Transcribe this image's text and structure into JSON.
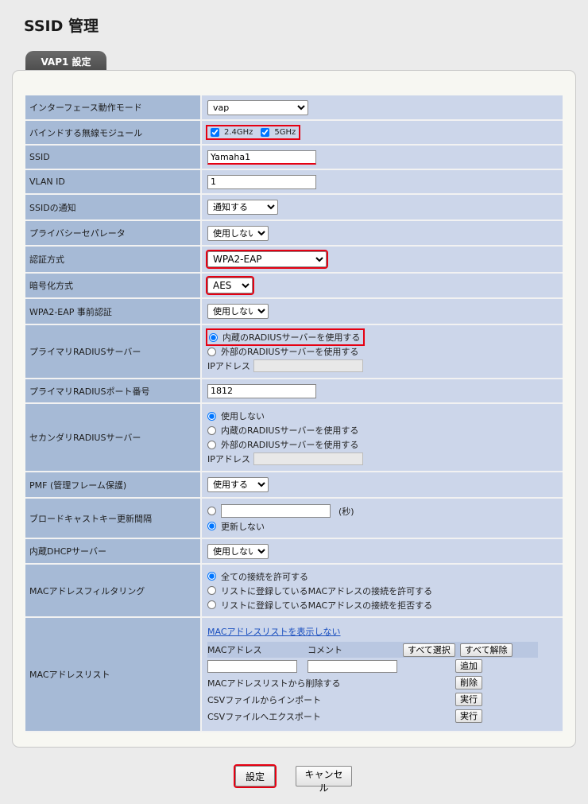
{
  "page": {
    "title": "SSID 管理",
    "tab_label": "VAP1 設定"
  },
  "rows": {
    "interface_mode": {
      "label": "インターフェース動作モード",
      "value": "vap"
    },
    "bind_module": {
      "label": "バインドする無線モジュール",
      "opt_24": "2.4GHz",
      "opt_5": "5GHz"
    },
    "ssid": {
      "label": "SSID",
      "value": "Yamaha1"
    },
    "vlan_id": {
      "label": "VLAN ID",
      "value": "1"
    },
    "ssid_notify": {
      "label": "SSIDの通知",
      "value": "通知する"
    },
    "privacy_separator": {
      "label": "プライバシーセパレータ",
      "value": "使用しない"
    },
    "auth_method": {
      "label": "認証方式",
      "value": "WPA2-EAP"
    },
    "encryption": {
      "label": "暗号化方式",
      "value": "AES"
    },
    "wpa2_preauth": {
      "label": "WPA2-EAP 事前認証",
      "value": "使用しない"
    },
    "primary_radius": {
      "label": "プライマリRADIUSサーバー",
      "opt_internal": "内蔵のRADIUSサーバーを使用する",
      "opt_external": "外部のRADIUSサーバーを使用する",
      "ip_label": "IPアドレス"
    },
    "primary_radius_port": {
      "label": "プライマリRADIUSポート番号",
      "value": "1812"
    },
    "secondary_radius": {
      "label": "セカンダリRADIUSサーバー",
      "opt_none": "使用しない",
      "opt_internal": "内蔵のRADIUSサーバーを使用する",
      "opt_external": "外部のRADIUSサーバーを使用する",
      "ip_label": "IPアドレス"
    },
    "pmf": {
      "label": "PMF (管理フレーム保護)",
      "value": "使用する"
    },
    "broadcast_key": {
      "label": "ブロードキャストキー更新間隔",
      "unit": "(秒)",
      "opt_no_update": "更新しない"
    },
    "dhcp": {
      "label": "内蔵DHCPサーバー",
      "value": "使用しない"
    },
    "mac_filter": {
      "label": "MACアドレスフィルタリング",
      "opt_all": "全ての接続を許可する",
      "opt_allow": "リストに登録しているMACアドレスの接続を許可する",
      "opt_deny": "リストに登録しているMACアドレスの接続を拒否する"
    },
    "mac_list": {
      "label": "MACアドレスリスト",
      "hide_link": "MACアドレスリストを表示しない",
      "col_mac": "MACアドレス",
      "col_comment": "コメント",
      "select_all": "すべて選択",
      "deselect_all": "すべて解除",
      "add": "追加",
      "delete_label": "MACアドレスリストから削除する",
      "delete": "削除",
      "import_label": "CSVファイルからインポート",
      "import": "実行",
      "export_label": "CSVファイルへエクスポート",
      "export": "実行"
    }
  },
  "footer": {
    "submit": "設定",
    "cancel": "キャンセル"
  }
}
